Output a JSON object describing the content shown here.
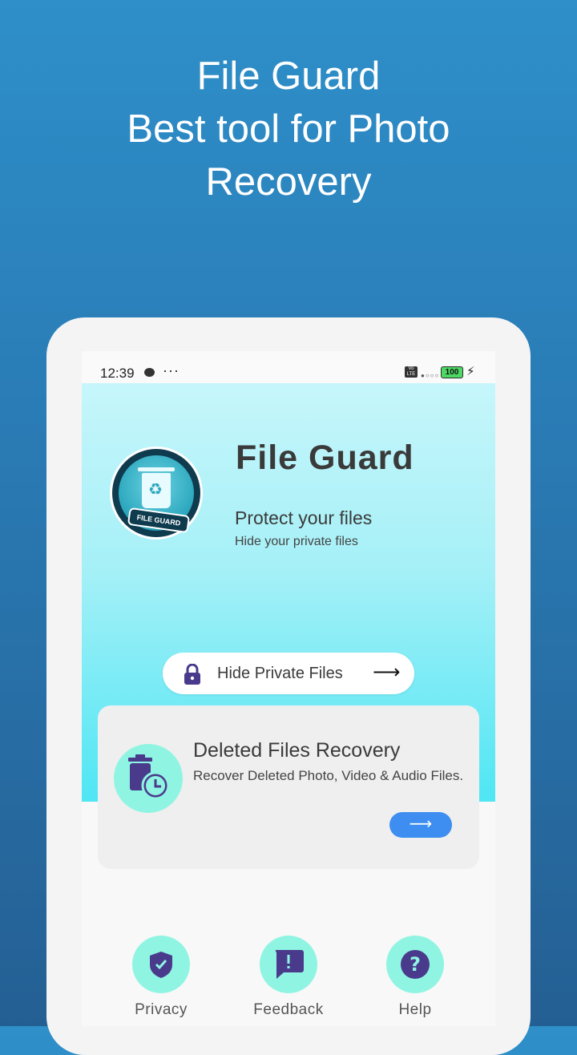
{
  "promo": {
    "line1": "File Guard",
    "line2": "Best tool for Photo",
    "line3": "Recovery"
  },
  "status_bar": {
    "time": "12:39",
    "more": "···",
    "volte": "Vo LTE",
    "signal": "●○○○",
    "battery": "100",
    "charging": "⚡"
  },
  "header": {
    "app_title": "File Guard",
    "logo_badge": "FILE GUARD",
    "tagline": "Protect your files",
    "subtag": "Hide your private files"
  },
  "hide_button": {
    "label": "Hide Private Files",
    "arrow": "⟶"
  },
  "recovery_card": {
    "title": "Deleted Files Recovery",
    "description": "Recover Deleted Photo, Video & Audio Files.",
    "go": "⟶"
  },
  "bottom_nav": [
    {
      "label": "Privacy",
      "icon": "shield-check-icon"
    },
    {
      "label": "Feedback",
      "icon": "feedback-icon"
    },
    {
      "label": "Help",
      "icon": "help-icon"
    }
  ],
  "colors": {
    "accent_mint": "#8ff5e2",
    "icon_purple": "#4a3a8c",
    "button_blue": "#3d8ef0"
  }
}
